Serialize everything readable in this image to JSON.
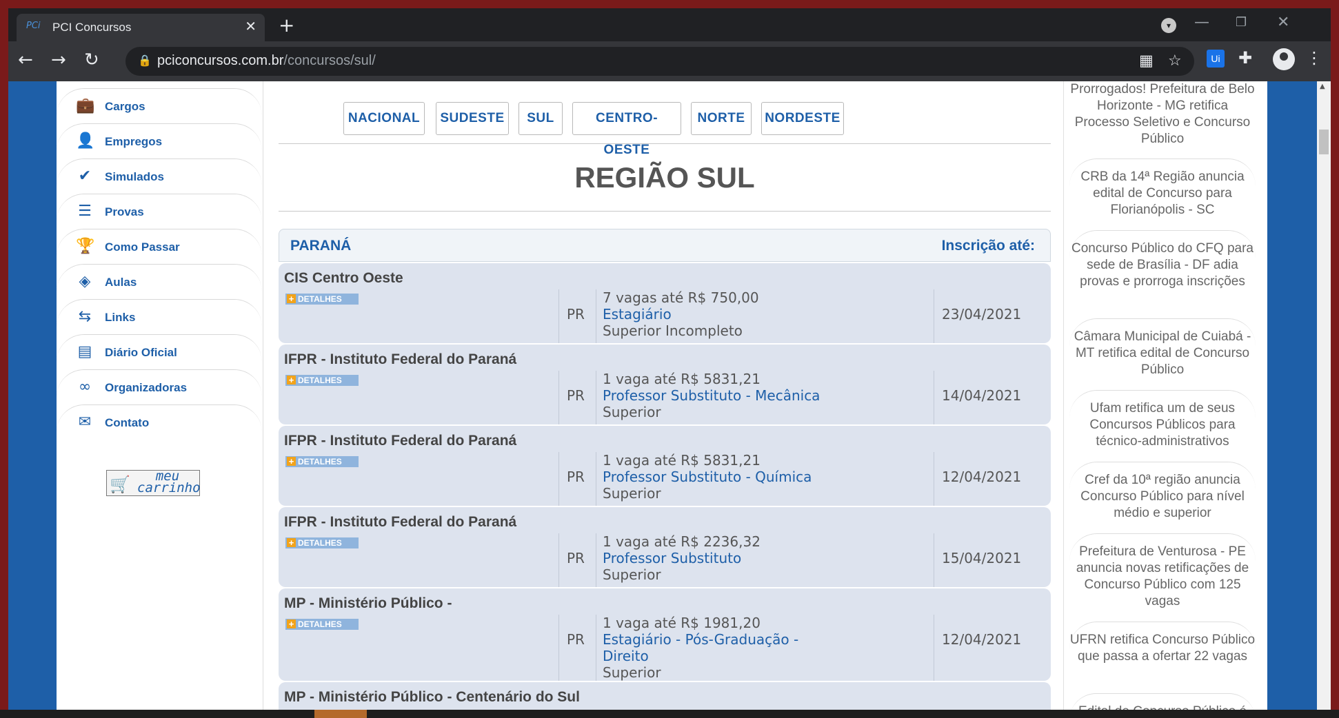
{
  "browser": {
    "tab_title": "PCI Concursos",
    "tab_favicon": "PCi",
    "url_host": "pciconcursos.com.br",
    "url_path": "/concursos/sul/",
    "ext_label": "Ui"
  },
  "sidebar": {
    "items": [
      {
        "label": "Cargos",
        "icon": "briefcase-icon"
      },
      {
        "label": "Empregos",
        "icon": "person-icon"
      },
      {
        "label": "Simulados",
        "icon": "check-circle-icon"
      },
      {
        "label": "Provas",
        "icon": "document-icon"
      },
      {
        "label": "Como Passar",
        "icon": "trophy-icon"
      },
      {
        "label": "Aulas",
        "icon": "play-icon"
      },
      {
        "label": "Links",
        "icon": "link-icon"
      },
      {
        "label": "Diário Oficial",
        "icon": "newspaper-icon"
      },
      {
        "label": "Organizadoras",
        "icon": "grid-icon"
      },
      {
        "label": "Contato",
        "icon": "envelope-icon"
      }
    ],
    "cart_line1": "meu",
    "cart_line2": "carrinho"
  },
  "regions": [
    "NACIONAL",
    "SUDESTE",
    "SUL",
    "CENTRO-OESTE",
    "NORTE",
    "NORDESTE"
  ],
  "page_title": "REGIÃO SUL",
  "state": {
    "name": "PARANÁ",
    "deadline_header": "Inscrição até:"
  },
  "details_label": "DETALHES",
  "listings": [
    {
      "org": "CIS Centro Oeste",
      "uf": "PR",
      "vagas": "7 vagas até R$ 750,00",
      "role": "Estagiário",
      "level": "Superior Incompleto",
      "date": "23/04/2021"
    },
    {
      "org": "IFPR - Instituto Federal do Paraná",
      "uf": "PR",
      "vagas": "1 vaga até R$ 5831,21",
      "role": "Professor Substituto - Mecânica",
      "level": "Superior",
      "date": "14/04/2021"
    },
    {
      "org": "IFPR - Instituto Federal do Paraná",
      "uf": "PR",
      "vagas": "1 vaga até R$ 5831,21",
      "role": "Professor Substituto - Química",
      "level": "Superior",
      "date": "12/04/2021"
    },
    {
      "org": "IFPR - Instituto Federal do Paraná",
      "uf": "PR",
      "vagas": "1 vaga até R$ 2236,32",
      "role": "Professor Substituto",
      "level": "Superior",
      "date": "15/04/2021"
    },
    {
      "org": "MP - Ministério Público -",
      "uf": "PR",
      "vagas": "1 vaga até R$ 1981,20",
      "role": "Estagiário - Pós-Graduação - Direito",
      "level": "Superior",
      "date": "12/04/2021"
    },
    {
      "org": "MP - Ministério Público - Centenário do Sul",
      "uf": "",
      "vagas": "",
      "role": "",
      "level": "",
      "date": ""
    }
  ],
  "news": [
    "Prorrogados! Prefeitura de Belo Horizonte - MG retifica Processo Seletivo e Concurso Público",
    "CRB da 14ª Região anuncia edital de Concurso para Florianópolis - SC",
    "Concurso Público do CFQ para sede de Brasília - DF adia provas e prorroga inscrições",
    "Câmara Municipal de Cuiabá - MT retifica edital de Concurso Público",
    "Ufam retifica um de seus Concursos Públicos para técnico-administrativos",
    "Cref da 10ª região anuncia Concurso Público para nível médio e superior",
    "Prefeitura de Venturosa - PE anuncia novas retificações de Concurso Público com 125 vagas",
    "UFRN retifica Concurso Público que passa a ofertar 22 vagas",
    "Edital de Concurso Público é"
  ]
}
